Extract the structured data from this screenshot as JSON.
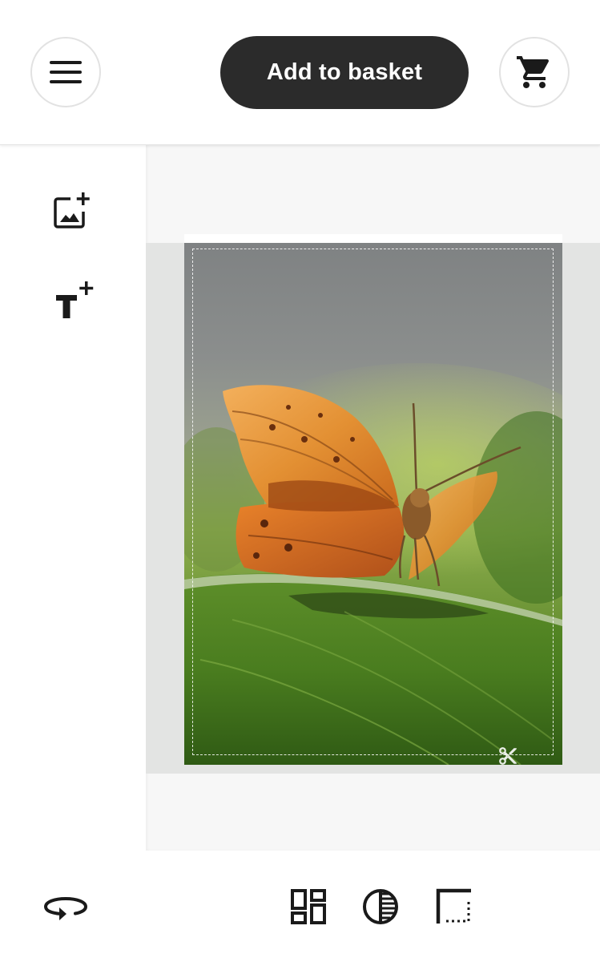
{
  "header": {
    "menu_icon": "hamburger-menu-icon",
    "add_to_basket_label": "Add to basket",
    "cart_icon": "shopping-cart-icon"
  },
  "tools": [
    {
      "icon": "add-image-icon"
    },
    {
      "icon": "add-text-icon"
    }
  ],
  "canvas": {
    "photo_subject": "butterfly-on-leaf-photo",
    "cut_marker_icon": "scissors-icon"
  },
  "bottom_toolbar": [
    {
      "icon": "rotate-icon"
    },
    {
      "icon": "layout-grid-icon"
    },
    {
      "icon": "contrast-filter-icon"
    },
    {
      "icon": "crop-bleed-icon"
    }
  ],
  "colors": {
    "primary_button": "#2b2b2b",
    "primary_button_text": "#ffffff",
    "canvas_background": "#f7f7f7",
    "bleed_background": "#e3e4e3",
    "icon": "#1a1a1a"
  }
}
